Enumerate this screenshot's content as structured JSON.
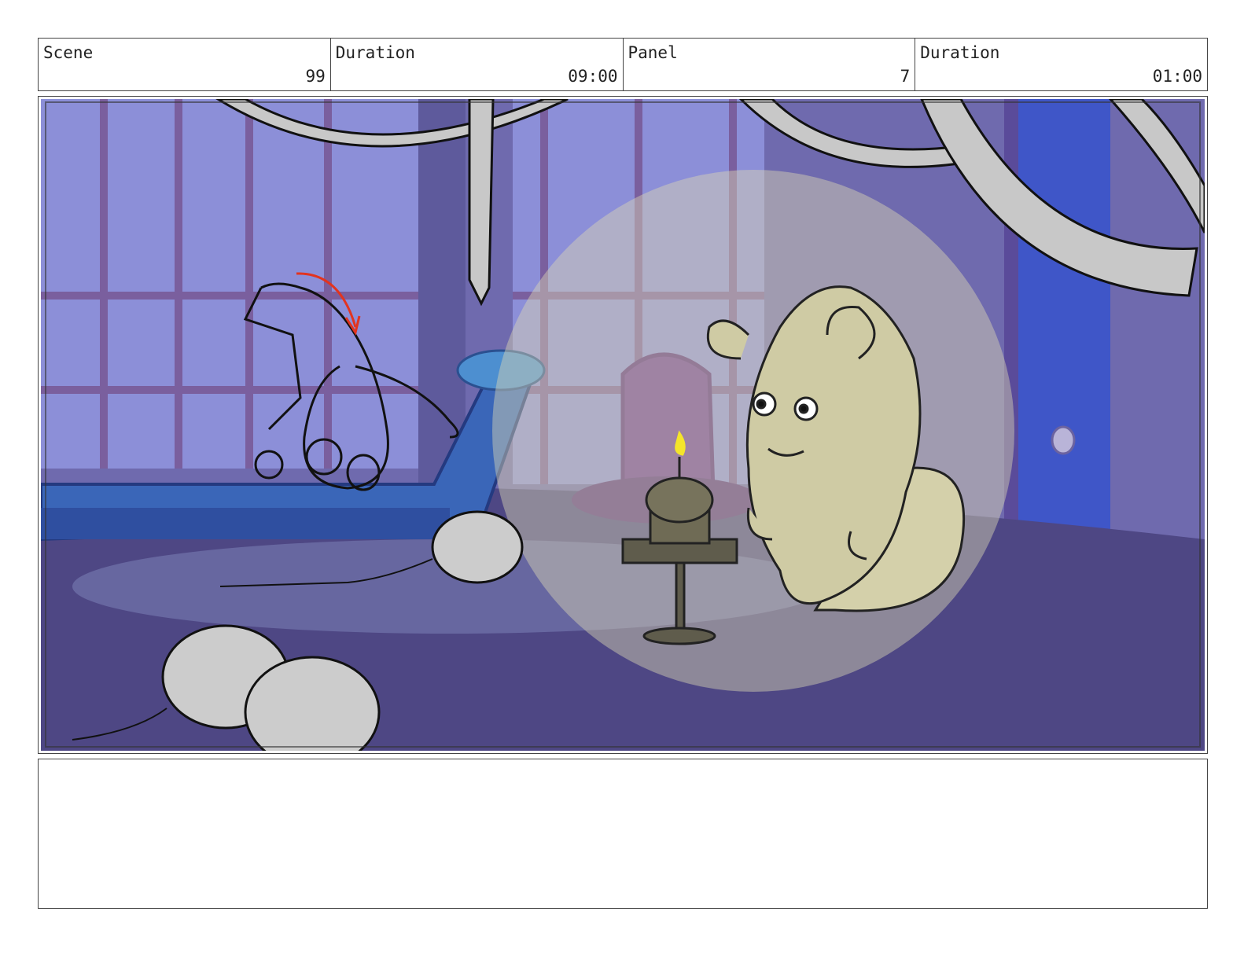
{
  "header": {
    "scene_label": "Scene",
    "scene_value": "99",
    "duration_label": "Duration",
    "scene_duration": "09:00",
    "panel_label": "Panel",
    "panel_value": "7",
    "panel_duration_label": "Duration",
    "panel_duration": "01:00"
  },
  "notes": {
    "text": ""
  },
  "colors": {
    "wall": "#6f6aae",
    "floor": "#4e4784",
    "window_glass": "#8c8fd8",
    "spotlight": "#dcd8b4",
    "creature": "#cfcba4",
    "balloon": "#cccccc",
    "streamer": "#c8c8c8",
    "motion_arrow": "#e2341f",
    "candle_flame": "#f4e52a"
  }
}
